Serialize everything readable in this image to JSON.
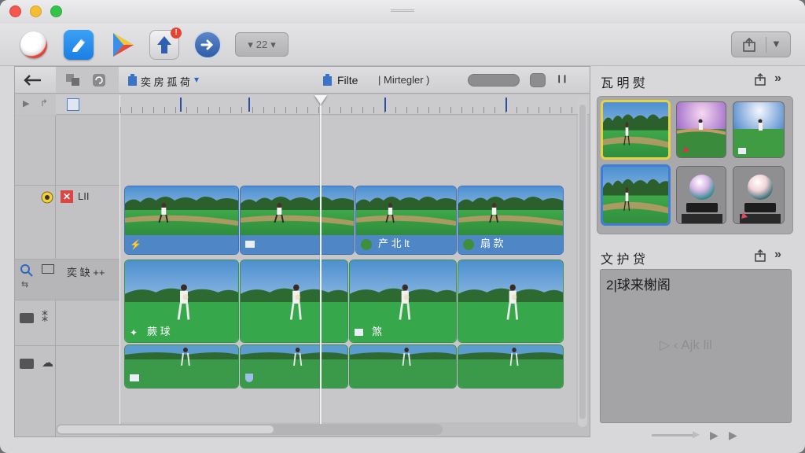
{
  "toolbar": {
    "zoom_value": "22",
    "share_badge": "!"
  },
  "timeline": {
    "project_tab_label": "奕 房 孤 荷",
    "filter_tab_label": "Filte",
    "filter_hint": "| Mirtegler )"
  },
  "tracks": [
    {
      "name": "LII",
      "row": "top"
    },
    {
      "name": "奕 缺 ++",
      "row": "middle"
    }
  ],
  "clips_top": [
    {
      "label": ""
    },
    {
      "label": ""
    },
    {
      "label": "产 北 lt"
    },
    {
      "label": "扇 款"
    }
  ],
  "clips_middle": [
    {
      "label": "蕨 球"
    },
    {
      "label": ""
    },
    {
      "label": "煞"
    },
    {
      "label": ""
    }
  ],
  "right_panel": {
    "browser_title": "瓦 明 熨",
    "viewer_title": "文 护 贷",
    "viewer_caption": "2|球来榭阁",
    "viewer_watermark": "▷ ‹ Ajk lil"
  },
  "colors": {
    "clip_bar_blue": "#4f86c6",
    "selection_yellow": "#e8d143",
    "selection_blue": "#3d7fd6",
    "field_green": "#2e9a3a"
  },
  "icons": [
    "record-icon",
    "edit-icon",
    "play-icon",
    "share-icon",
    "forward-icon",
    "export-icon",
    "expand-icon"
  ]
}
